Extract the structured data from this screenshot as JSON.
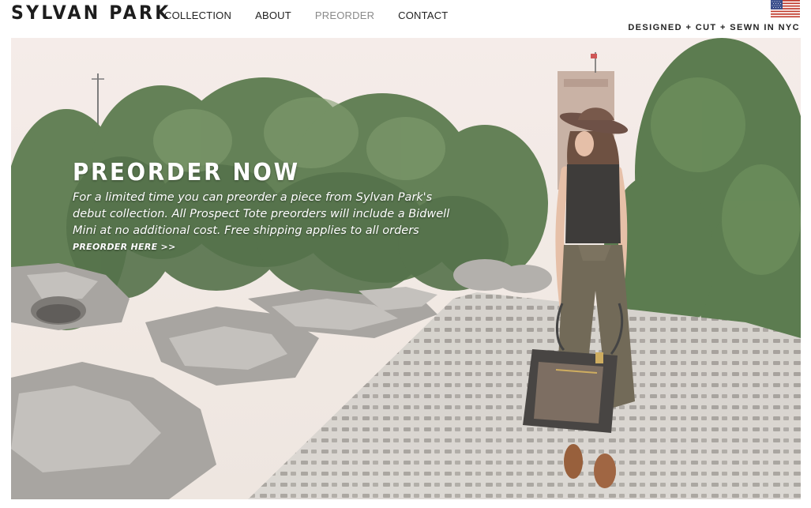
{
  "brand": {
    "name": "SYLVAN PARK"
  },
  "nav": {
    "items": [
      {
        "label": "COLLECTION",
        "active": false
      },
      {
        "label": "ABOUT",
        "active": false
      },
      {
        "label": "PREORDER",
        "active": true
      },
      {
        "label": "CONTACT",
        "active": false
      }
    ]
  },
  "header": {
    "flag_icon": "us-flag-icon",
    "tagline": "DESIGNED + CUT + SEWN IN NYC"
  },
  "hero": {
    "heading": "PREORDER NOW",
    "body": "For a limited time you can preorder a piece from Sylvan Park's debut collection. All Prospect Tote preorders will include a Bidwell Mini at no additional cost. Free shipping applies to all orders",
    "cta": "PREORDER HERE >>"
  },
  "colors": {
    "nav_active": "#8a8a8a",
    "text": "#222222",
    "hero_text": "#ffffff"
  }
}
